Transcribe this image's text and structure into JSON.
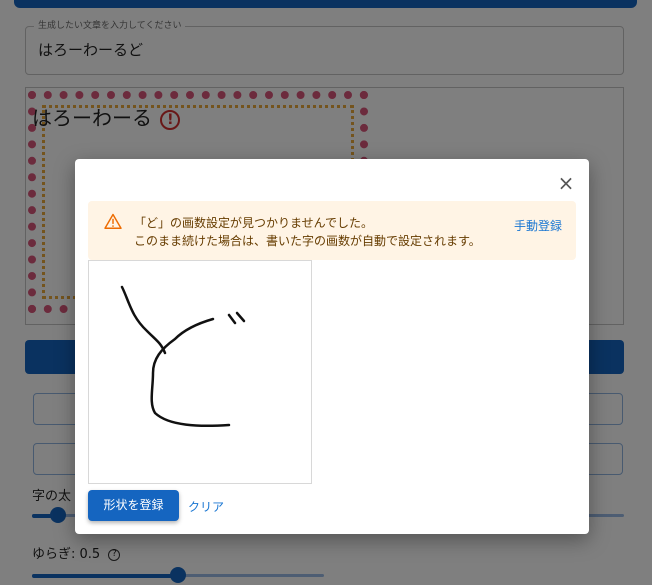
{
  "form": {
    "input_label": "生成したい文章を入力してください",
    "input_value": "はろーわーるど"
  },
  "preview": {
    "text": "はろーわーる",
    "error_mark": "!"
  },
  "settings": {
    "stroke_width_label": "字の太",
    "fluctuation_label": "ゆらぎ: 0.5",
    "fluctuation_value": 0.5,
    "help_glyph": "?"
  },
  "dialog": {
    "close_glyph": "×",
    "alert_line1": "「ど」の画数設定が見つかりませんでした。",
    "alert_line2": "このまま続けた場合は、書いた字の画数が自動で設定されます。",
    "manual_register": "手動登録",
    "register_shape": "形状を登録",
    "clear": "クリア"
  },
  "colors": {
    "primary": "#1565c0",
    "warning_bg": "#fff4e5",
    "warning_icon": "#ed6c02",
    "error": "#d32f2f"
  }
}
